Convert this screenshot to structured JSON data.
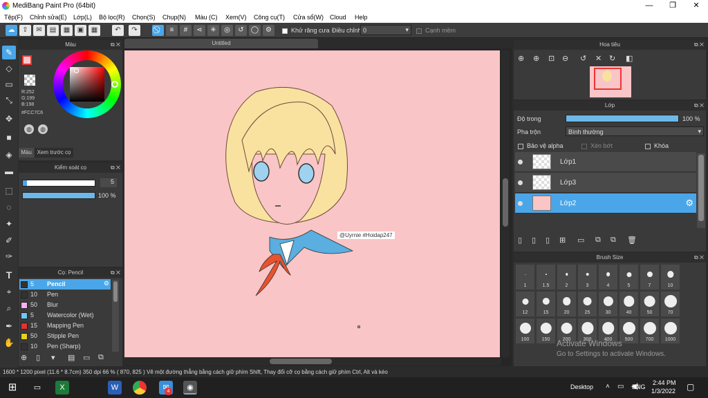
{
  "window": {
    "title": "MediBang Paint Pro (64bit)",
    "min": "—",
    "max": "❐",
    "close": "✕"
  },
  "menu": [
    "Tệp(F)",
    "Chỉnh sửa(E)",
    "Lớp(L)",
    "Bộ lọc(R)",
    "Chọn(S)",
    "Chụp(N)",
    "Màu (C)",
    "Xem(V)",
    "Công cụ(T)",
    "Cửa sổ(W)",
    "Cloud",
    "Help"
  ],
  "toolbar": {
    "antialias_label": "Khử răng cưa",
    "correction_label": "Điều chỉnh",
    "correction_value": "0",
    "edge_label": "Cạnh mềm"
  },
  "canvas": {
    "tab_title": "Untitled",
    "watermark": "@Uyrnie #Hoidap247",
    "bg_color": "#f9c5c6"
  },
  "color_panel": {
    "title": "Màu",
    "r": "R:252",
    "g": "G:199",
    "b": "B:198",
    "hex": "#FCC7C6",
    "tab1": "Màu",
    "tab2": "Xem trước cọ",
    "fg_color": "#fcc7c6"
  },
  "brush_control": {
    "title": "Kiểm soát cọ",
    "size_value": "5",
    "opacity_value": "100 %"
  },
  "brush_list": {
    "title": "Cọ: Pencil",
    "items": [
      {
        "color": "#333333",
        "size": "5",
        "name": "Pencil",
        "selected": true
      },
      {
        "color": "#333333",
        "size": "10",
        "name": "Pen"
      },
      {
        "color": "#f8b0f0",
        "size": "50",
        "name": "Blur"
      },
      {
        "color": "#70c8f0",
        "size": "5",
        "name": "Watercolor (Wet)"
      },
      {
        "color": "#e83030",
        "size": "15",
        "name": "Mapping Pen"
      },
      {
        "color": "#e8d020",
        "size": "50",
        "name": "Stipple Pen"
      },
      {
        "color": "#333333",
        "size": "10",
        "name": "Pen (Sharp)"
      }
    ]
  },
  "navigator": {
    "title": "Hoa tiêu"
  },
  "layers": {
    "title": "Lớp",
    "opacity_label": "Độ trong",
    "opacity_value": "100 %",
    "opacity_fraction": 1.0,
    "blend_label": "Pha trộn",
    "blend_value": "Bình thường",
    "protect_alpha": "Bảo vệ alpha",
    "clipping": "Xén bớt",
    "lock": "Khóa",
    "items": [
      {
        "name": "Lớp1"
      },
      {
        "name": "Lớp3"
      },
      {
        "name": "Lớp2",
        "selected": true
      }
    ]
  },
  "brush_size": {
    "title": "Brush Size",
    "sizes": [
      "1",
      "1.5",
      "2",
      "3",
      "4",
      "5",
      "7",
      "10",
      "12",
      "15",
      "20",
      "25",
      "30",
      "40",
      "50",
      "70",
      "100",
      "150",
      "200",
      "300",
      "400",
      "500",
      "700",
      "1000"
    ]
  },
  "activate": {
    "line1": "Activate Windows",
    "line2": "Go to Settings to activate Windows."
  },
  "status": "1600 * 1200 pixel   (11.6 * 8.7cm)   350 dpi   66 %   ( 870, 825 )   Vẽ một đường thẳng bằng cách giữ phím Shift, Thay đổi cỡ cọ bằng cách giữ phím Ctrl, Alt và kéo",
  "taskbar": {
    "desktop": "Desktop",
    "lang": "ENG",
    "time": "2:44 PM",
    "date": "1/3/2022",
    "badge": "4"
  }
}
